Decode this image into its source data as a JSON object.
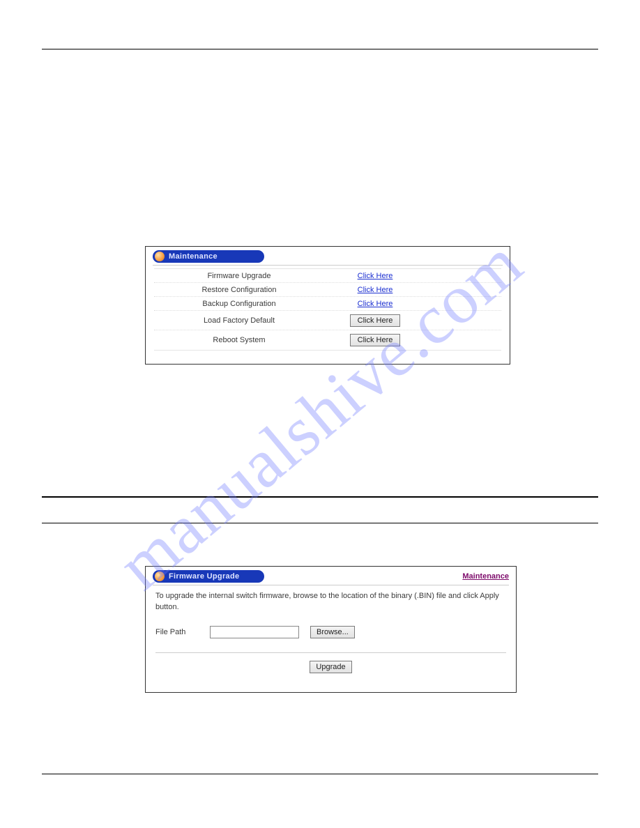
{
  "watermark": "manualshive.com",
  "panel1": {
    "title": "Maintenance",
    "rows": [
      {
        "label": "Firmware Upgrade",
        "action_type": "link",
        "action_text": "Click Here"
      },
      {
        "label": "Restore Configuration",
        "action_type": "link",
        "action_text": "Click Here"
      },
      {
        "label": "Backup Configuration",
        "action_type": "link",
        "action_text": "Click Here"
      },
      {
        "label": "Load Factory Default",
        "action_type": "button",
        "action_text": "Click Here"
      },
      {
        "label": "Reboot System",
        "action_type": "button",
        "action_text": "Click Here"
      }
    ]
  },
  "panel2": {
    "title": "Firmware Upgrade",
    "back_link": "Maintenance",
    "instructions": "To upgrade the internal switch firmware, browse to the location of the binary (.BIN) file and click Apply button.",
    "file_path_label": "File Path",
    "file_path_value": "",
    "browse_button": "Browse...",
    "upgrade_button": "Upgrade"
  }
}
